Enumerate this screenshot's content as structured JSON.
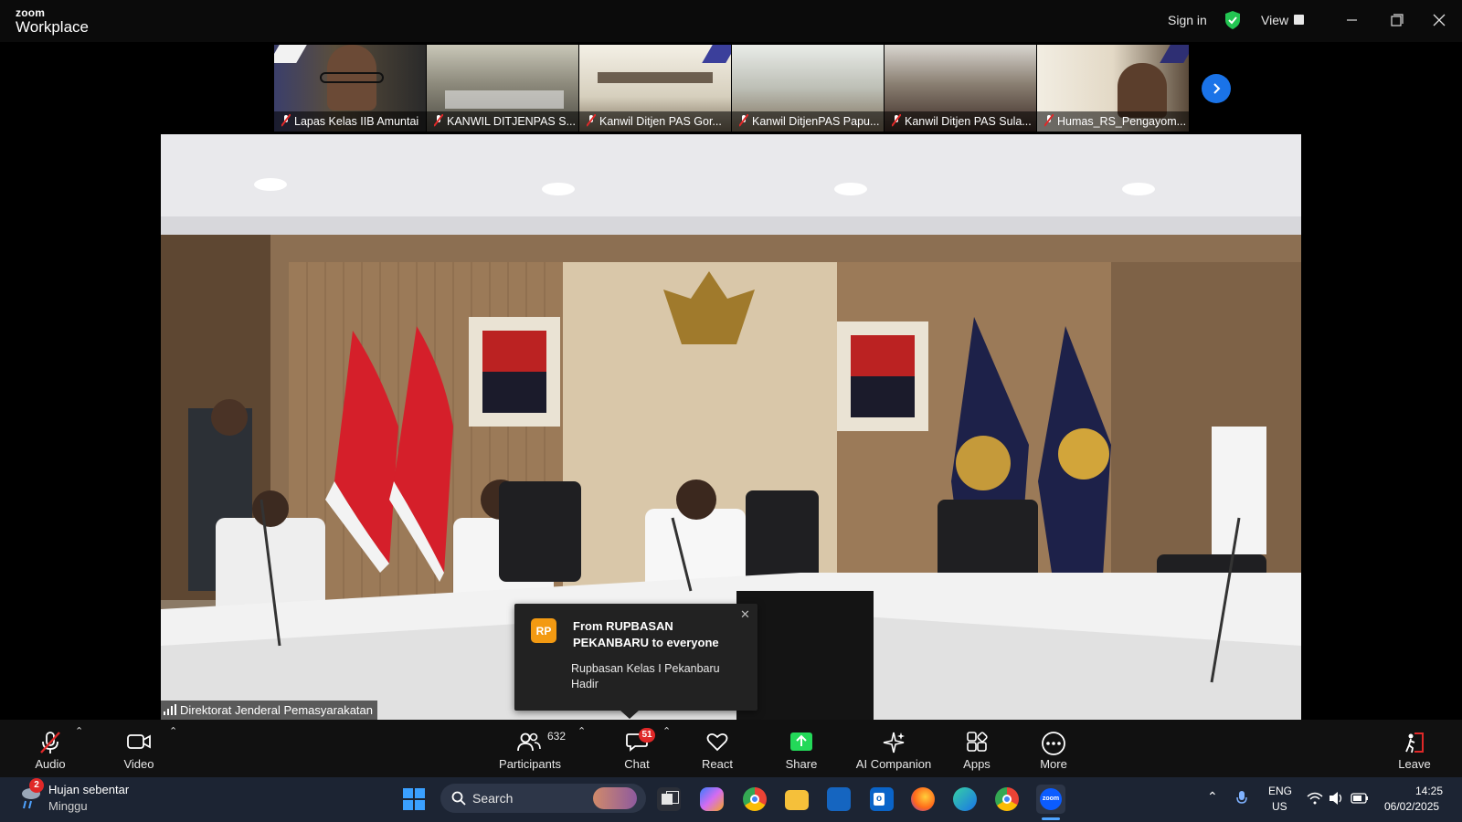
{
  "window": {
    "logo_line1": "zoom",
    "logo_line2": "Workplace",
    "sign_in": "Sign in",
    "view": "View"
  },
  "participants_strip": [
    {
      "name": "Lapas Kelas IIB Amuntai",
      "muted": true,
      "theme": "person"
    },
    {
      "name": "KANWIL DITJENPAS S...",
      "muted": true,
      "theme": "room"
    },
    {
      "name": "Kanwil Ditjen PAS Gor...",
      "muted": true,
      "theme": "banner"
    },
    {
      "name": "Kanwil DitjenPAS Papu...",
      "muted": true,
      "theme": "room-light"
    },
    {
      "name": "Kanwil Ditjen PAS Sula...",
      "muted": true,
      "theme": "room-dark"
    },
    {
      "name": "Humas_RS_Pengayom...",
      "muted": true,
      "theme": "banner-person"
    }
  ],
  "main_video": {
    "speaker_name": "Direktorat Jenderal Pemasyarakatan"
  },
  "chat_notification": {
    "initials": "RP",
    "from": "From RUPBASAN PEKANBARU to everyone",
    "message": "Rupbasan Kelas I Pekanbaru Hadir"
  },
  "toolbar": {
    "audio": "Audio",
    "video": "Video",
    "participants": "Participants",
    "participants_count": "632",
    "chat": "Chat",
    "chat_badge": "51",
    "react": "React",
    "share": "Share",
    "ai_companion": "AI Companion",
    "apps": "Apps",
    "more": "More",
    "leave": "Leave"
  },
  "taskbar": {
    "weather_badge": "2",
    "weather_line1": "Hujan sebentar",
    "weather_line2": "Minggu",
    "search_placeholder": "Search",
    "lang_line1": "ENG",
    "lang_line2": "US",
    "time": "14:25",
    "date": "06/02/2025"
  },
  "colors": {
    "accent_blue": "#1a73e8",
    "share_green": "#23d959",
    "muted_red": "#e02828",
    "avatar_orange": "#f39a12"
  }
}
